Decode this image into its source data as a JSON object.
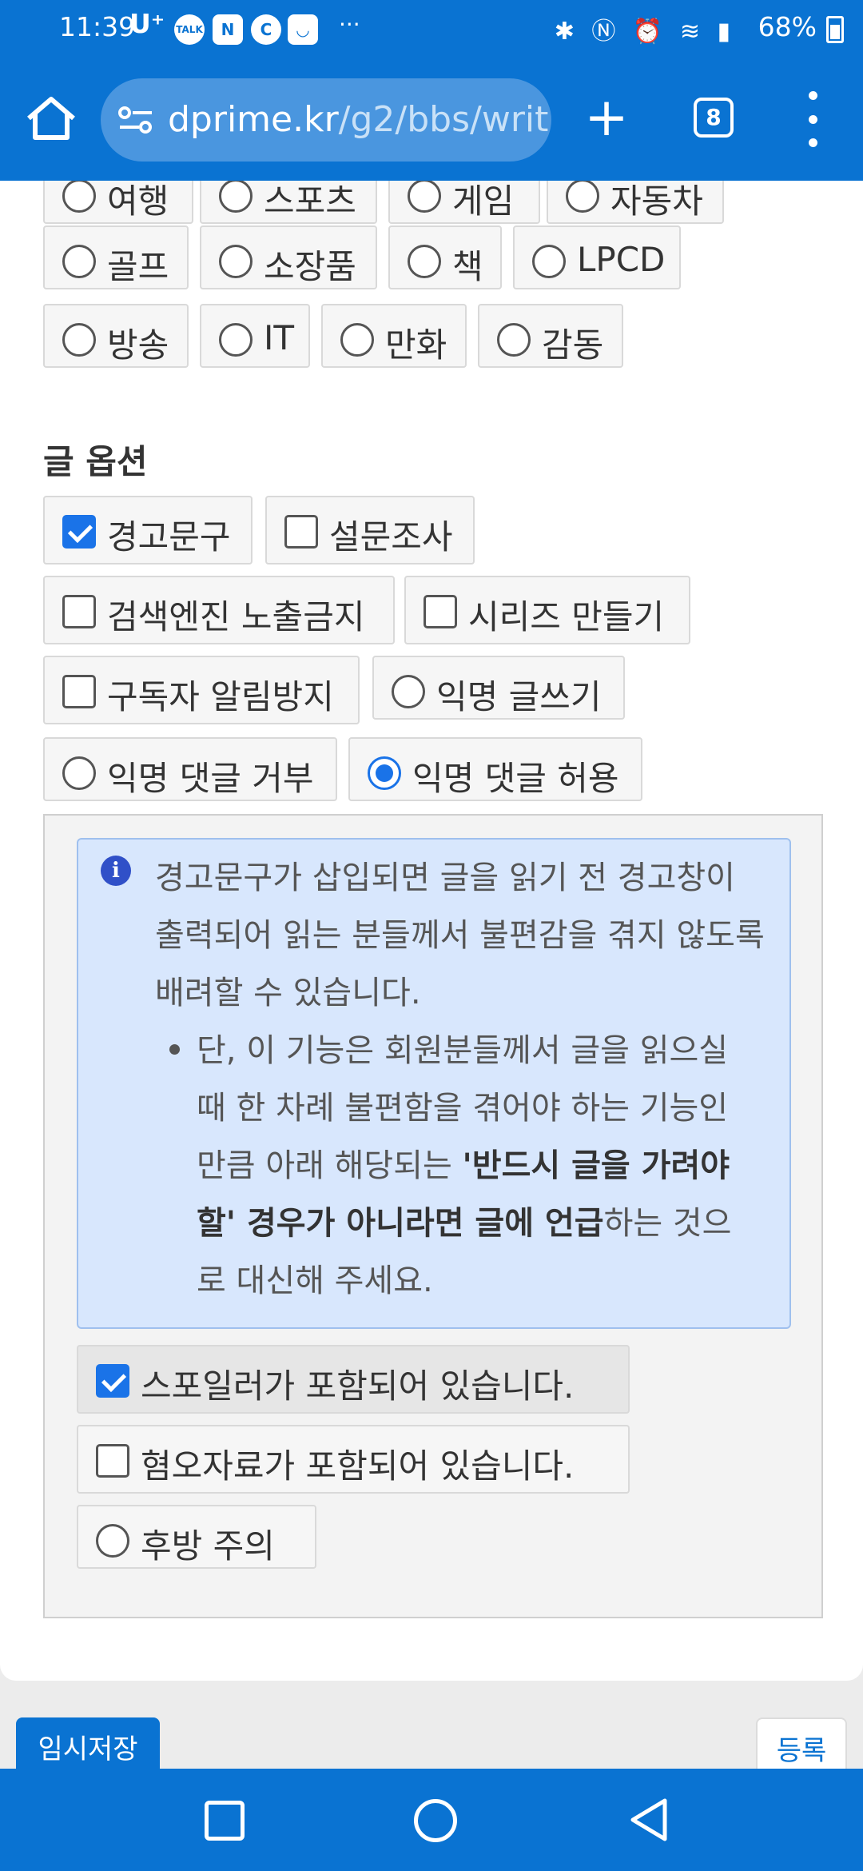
{
  "status_bar": {
    "time": "11:39",
    "carrier": "U⁺",
    "notif_icons": [
      "talk-icon",
      "naver-icon",
      "c-icon",
      "smile-icon"
    ],
    "more": "···",
    "battery": "68%"
  },
  "browser": {
    "url_host": "dprime.kr",
    "url_path": "/g2/bbs/writ",
    "tab_count": "8"
  },
  "categories_row0": [
    "여행",
    "스포츠",
    "게임",
    "자동차"
  ],
  "categories": [
    {
      "label": "골프",
      "selected": false
    },
    {
      "label": "소장품",
      "selected": false
    },
    {
      "label": "책",
      "selected": false
    },
    {
      "label": "LPCD",
      "selected": false
    },
    {
      "label": "방송",
      "selected": false
    },
    {
      "label": "IT",
      "selected": false
    },
    {
      "label": "만화",
      "selected": false
    },
    {
      "label": "감동",
      "selected": false
    }
  ],
  "post_options": {
    "title": "글 옵션",
    "warning": "경고문구",
    "survey": "설문조사",
    "no_search": "검색엔진 노출금지",
    "series": "시리즈 만들기",
    "no_notify": "구독자 알림방지",
    "anon_write": "익명 글쓰기",
    "anon_reject": "익명 댓글 거부",
    "anon_allow": "익명 댓글 허용"
  },
  "notice": {
    "text": "경고문구가 삽입되면 글을 읽기 전 경고창이 출력되어 읽는 분들께서 불편감을 겪지 않도록 배려할 수 있습니다.",
    "bullet_a": "단, 이 기능은 회원분들께서 글을 읽으실 때 한 차례 불편함을 겪어야 하는 기능인 만큼 아래 해당되는 ",
    "bullet_bold": "'반드시 글을 가려야 할' 경우가 아니라면 글에 언급",
    "bullet_b": "하는 것으로 대신해 주세요."
  },
  "warnings": {
    "spoiler": "스포일러가 포함되어 있습니다.",
    "disgust": "혐오자료가 포함되어 있습니다.",
    "flash": "후방 주의"
  },
  "footer": {
    "temp_save": "임시저장",
    "submit": "등록"
  },
  "colors": {
    "brand_blue": "#0a73d2",
    "info_bg": "#d8e7fd",
    "accent": "#1a73e8"
  }
}
